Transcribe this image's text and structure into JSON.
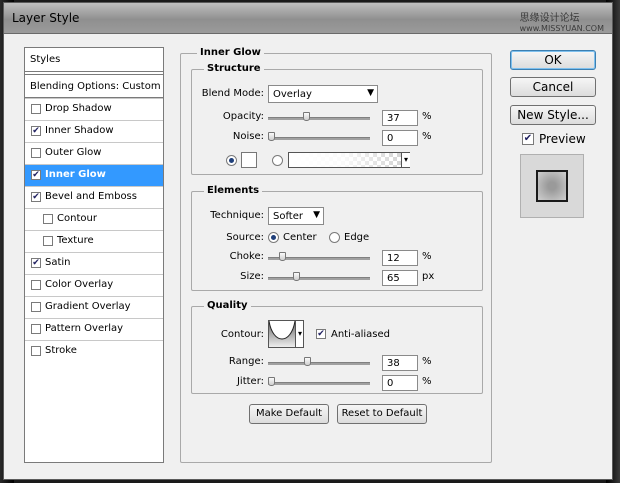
{
  "window": {
    "title": "Layer Style",
    "watermark": "思缘设计论坛",
    "watermark_sub": "www.MISSYUAN.COM"
  },
  "sidebar": {
    "header": "Styles",
    "blending": "Blending Options: Custom",
    "items": [
      {
        "label": "Drop Shadow",
        "checked": false,
        "indent": false,
        "selected": false
      },
      {
        "label": "Inner Shadow",
        "checked": true,
        "indent": false,
        "selected": false
      },
      {
        "label": "Outer Glow",
        "checked": false,
        "indent": false,
        "selected": false
      },
      {
        "label": "Inner Glow",
        "checked": true,
        "indent": false,
        "selected": true
      },
      {
        "label": "Bevel and Emboss",
        "checked": true,
        "indent": false,
        "selected": false
      },
      {
        "label": "Contour",
        "checked": false,
        "indent": true,
        "selected": false
      },
      {
        "label": "Texture",
        "checked": false,
        "indent": true,
        "selected": false
      },
      {
        "label": "Satin",
        "checked": true,
        "indent": false,
        "selected": false
      },
      {
        "label": "Color Overlay",
        "checked": false,
        "indent": false,
        "selected": false
      },
      {
        "label": "Gradient Overlay",
        "checked": false,
        "indent": false,
        "selected": false
      },
      {
        "label": "Pattern Overlay",
        "checked": false,
        "indent": false,
        "selected": false
      },
      {
        "label": "Stroke",
        "checked": false,
        "indent": false,
        "selected": false
      }
    ]
  },
  "main": {
    "title": "Inner Glow",
    "structure": {
      "title": "Structure",
      "blend_mode_label": "Blend Mode:",
      "blend_mode_value": "Overlay",
      "opacity_label": "Opacity:",
      "opacity_value": "37",
      "opacity_unit": "%",
      "opacity_fraction": 0.37,
      "noise_label": "Noise:",
      "noise_value": "0",
      "noise_unit": "%",
      "noise_fraction": 0.0
    },
    "elements": {
      "title": "Elements",
      "technique_label": "Technique:",
      "technique_value": "Softer",
      "source_label": "Source:",
      "source_center": "Center",
      "source_edge": "Edge",
      "choke_label": "Choke:",
      "choke_value": "12",
      "choke_unit": "%",
      "choke_fraction": 0.12,
      "size_label": "Size:",
      "size_value": "65",
      "size_unit": "px",
      "size_fraction": 0.26
    },
    "quality": {
      "title": "Quality",
      "contour_label": "Contour:",
      "antialiased_label": "Anti-aliased",
      "range_label": "Range:",
      "range_value": "38",
      "range_unit": "%",
      "range_fraction": 0.38,
      "jitter_label": "Jitter:",
      "jitter_value": "0",
      "jitter_unit": "%",
      "jitter_fraction": 0.0
    },
    "make_default": "Make Default",
    "reset_default": "Reset to Default"
  },
  "actions": {
    "ok": "OK",
    "cancel": "Cancel",
    "new_style": "New Style...",
    "preview": "Preview"
  },
  "colors": {
    "selection": "#3399ff",
    "glow_color": "#ffffff"
  }
}
